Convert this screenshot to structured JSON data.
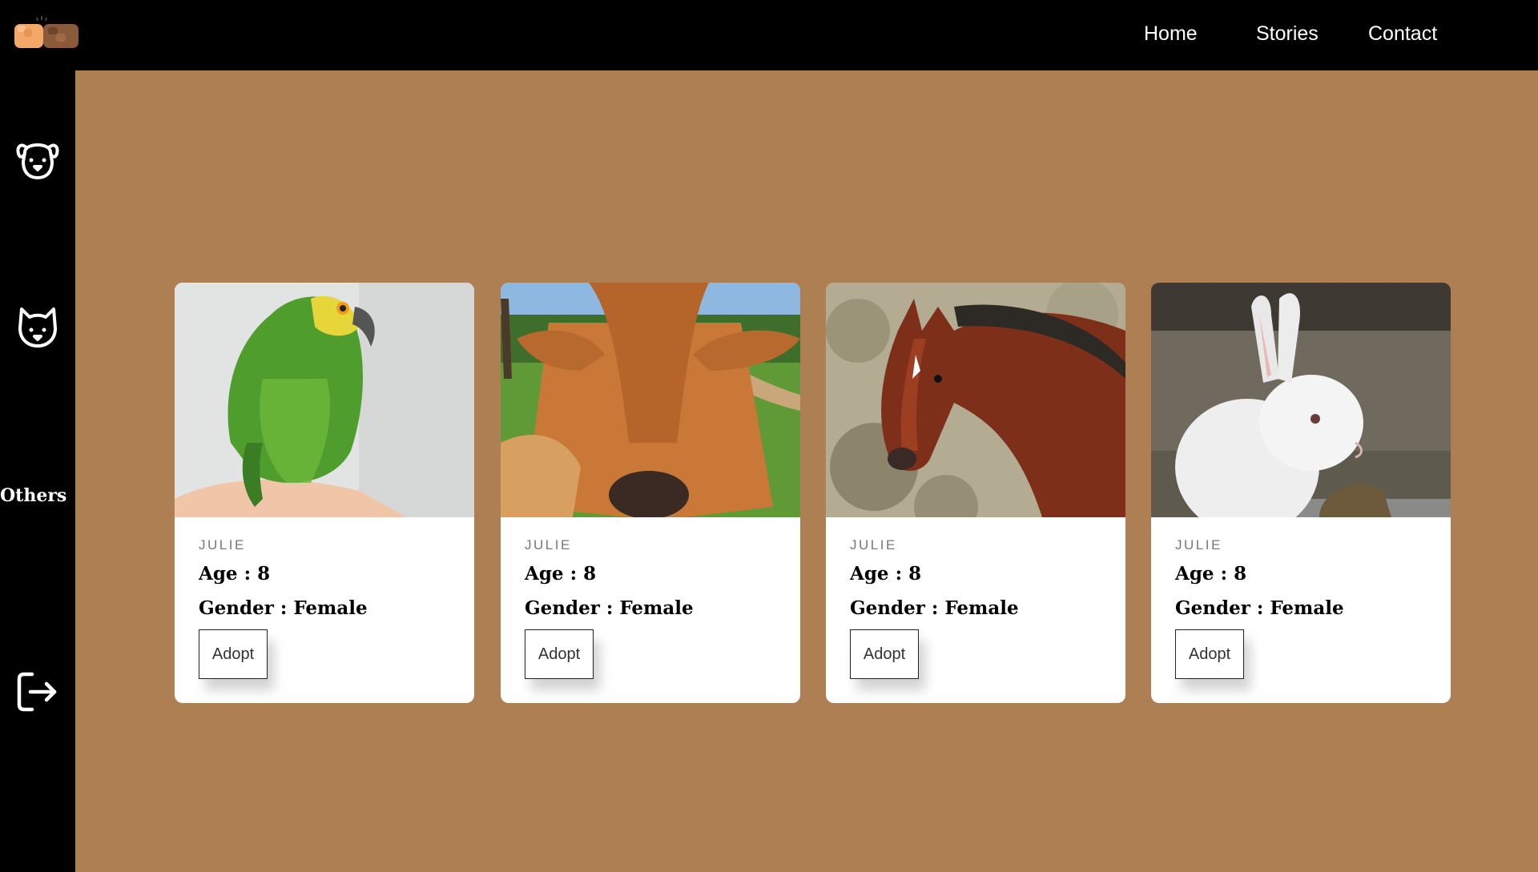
{
  "nav": {
    "home": "Home",
    "stories": "Stories",
    "contact": "Contact"
  },
  "sidebar": {
    "others_label": "Others"
  },
  "icons": {
    "logo": "fist-bump-logo",
    "dog": "dog-face-icon",
    "cat": "cat-face-icon",
    "logout": "logout-icon"
  },
  "colors": {
    "background": "#ad7f53",
    "bars": "#000000",
    "card": "#ffffff"
  },
  "cards": [
    {
      "animal": "parrot",
      "name": "JULIE",
      "age": "Age : 8",
      "gender": "Gender : Female",
      "button": "Adopt"
    },
    {
      "animal": "calf",
      "name": "JULIE",
      "age": "Age : 8",
      "gender": "Gender : Female",
      "button": "Adopt"
    },
    {
      "animal": "horse",
      "name": "JULIE",
      "age": "Age : 8",
      "gender": "Gender : Female",
      "button": "Adopt"
    },
    {
      "animal": "rabbit",
      "name": "JULIE",
      "age": "Age : 8",
      "gender": "Gender : Female",
      "button": "Adopt"
    }
  ]
}
